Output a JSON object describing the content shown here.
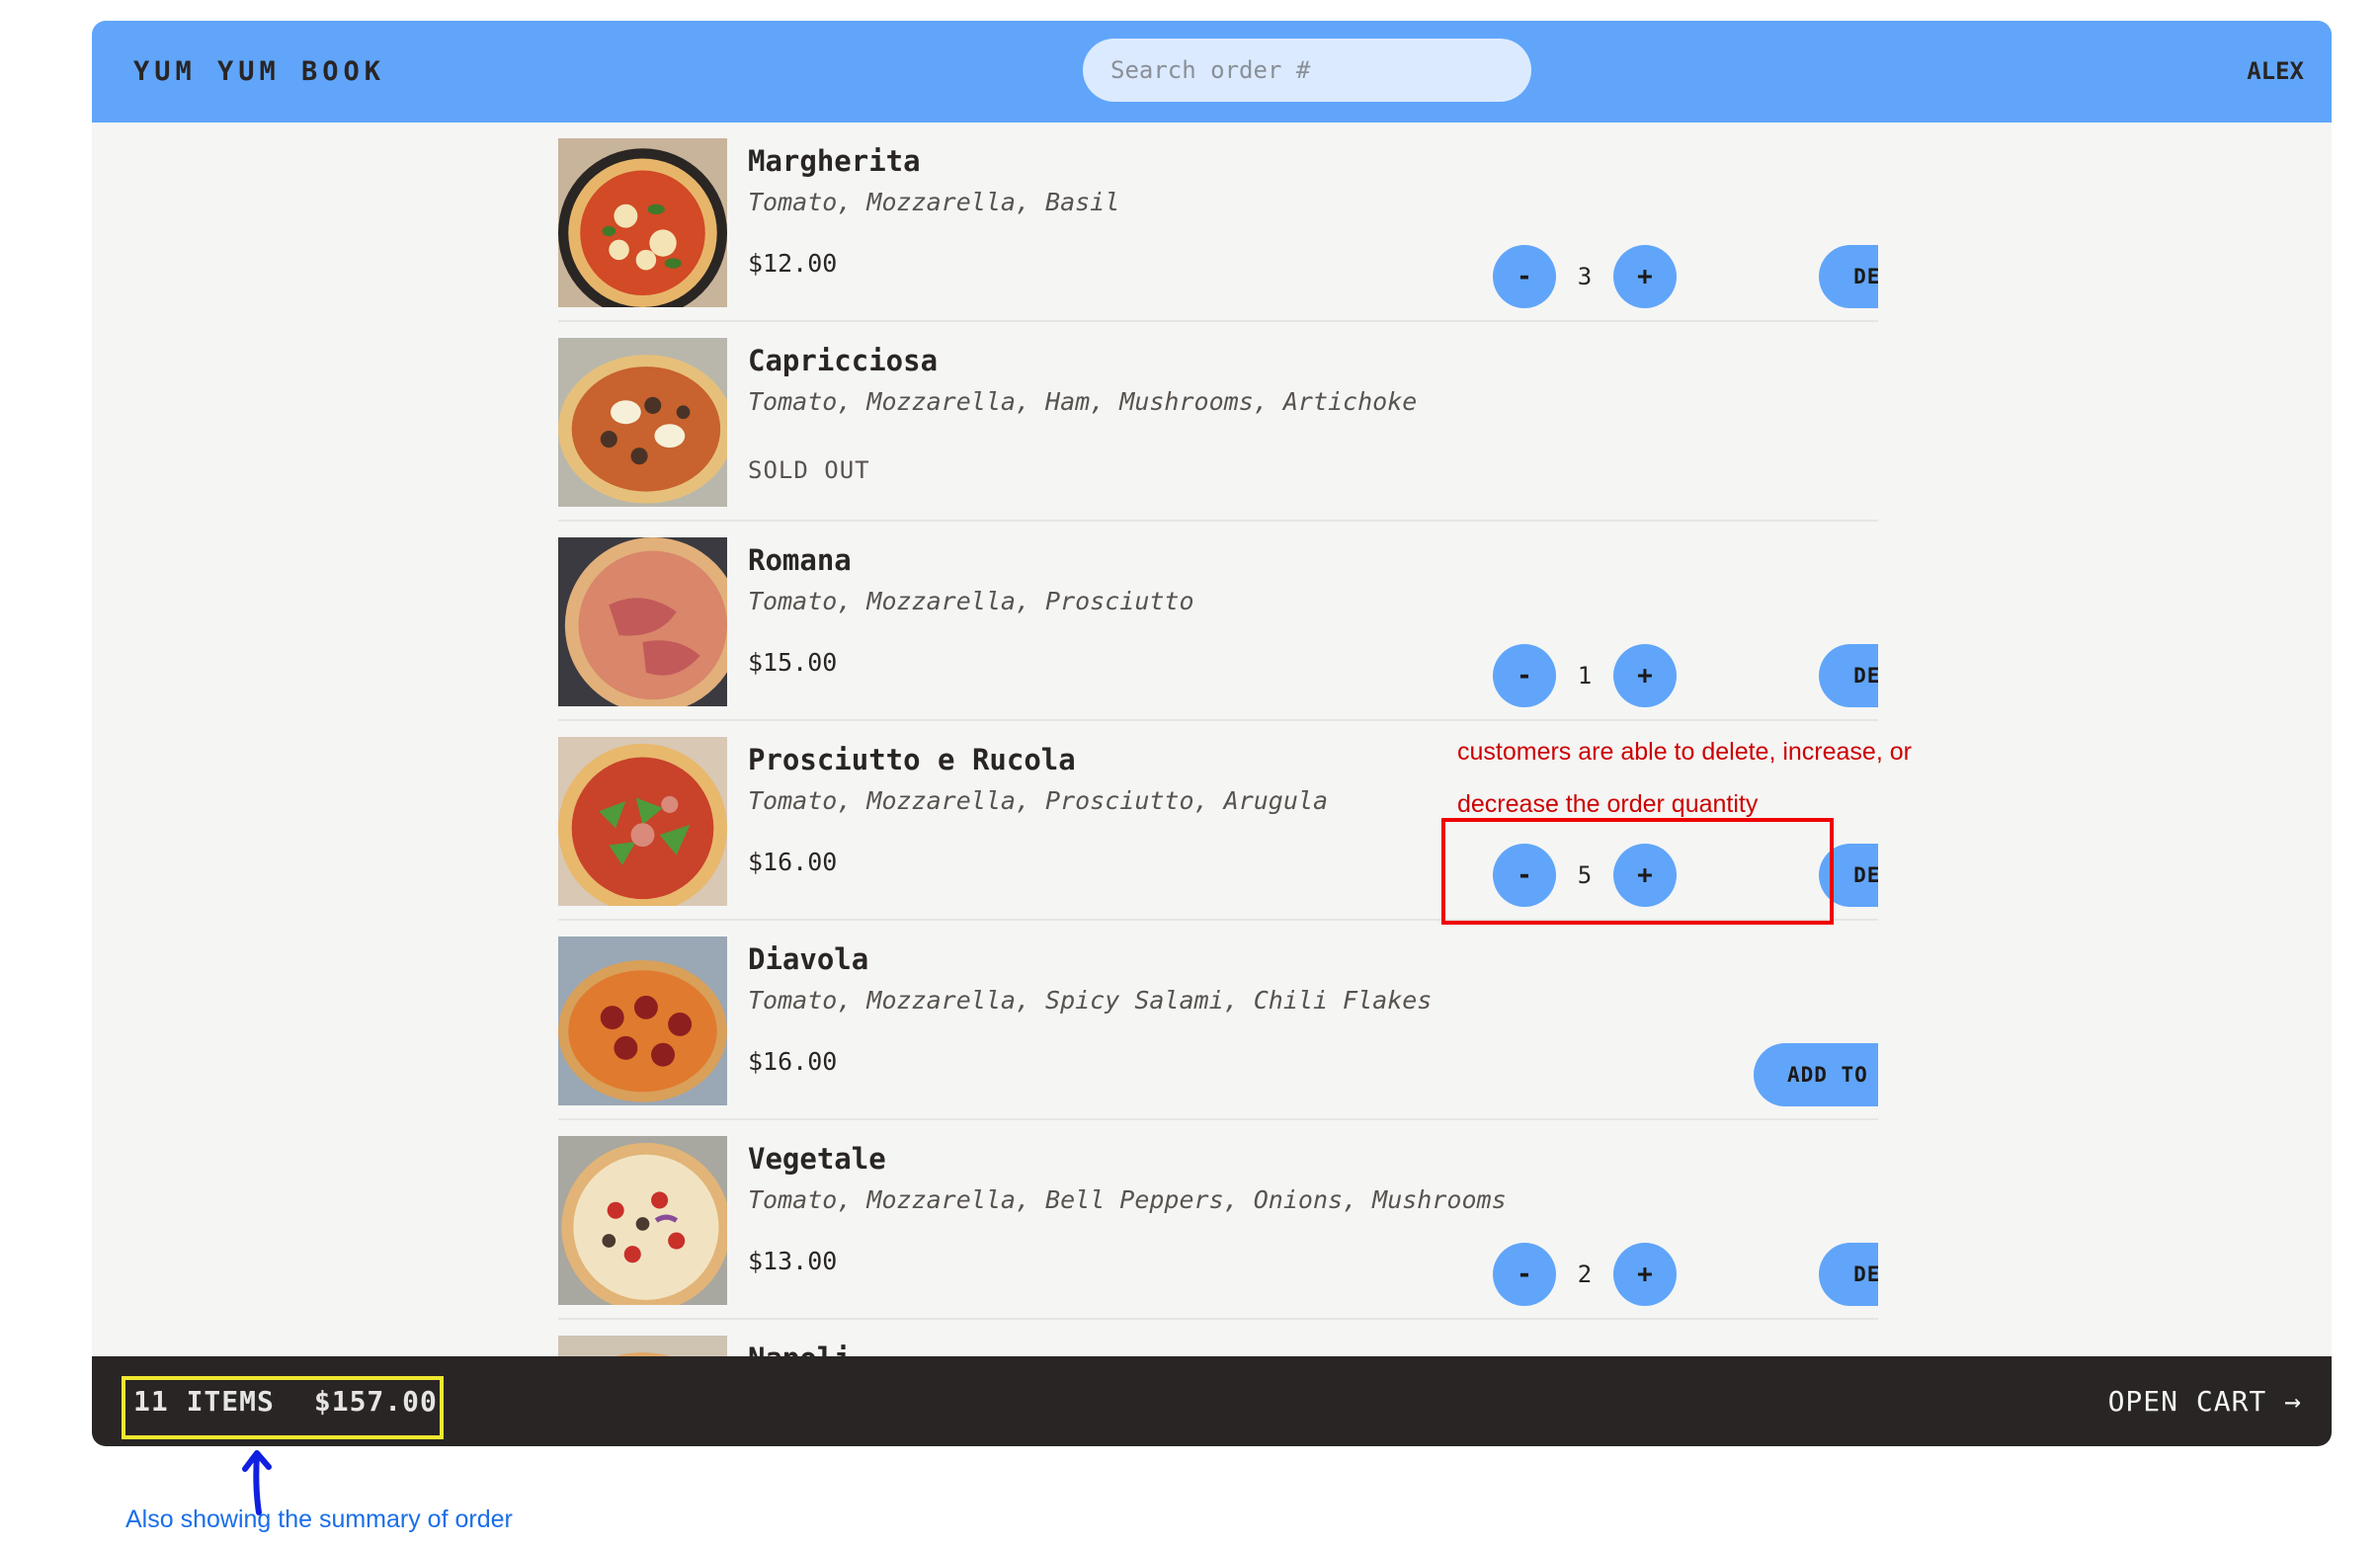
{
  "header": {
    "logo": "YUM YUM BOOK",
    "search_placeholder": "Search order #",
    "user": "ALEX"
  },
  "menu_items": [
    {
      "name": "Margherita",
      "ingredients": "Tomato, Mozzarella, Basil",
      "price": "$12.00",
      "quantity": "3",
      "state": "in_cart"
    },
    {
      "name": "Capricciosa",
      "ingredients": "Tomato, Mozzarella, Ham, Mushrooms, Artichoke",
      "status": "SOLD OUT",
      "state": "sold_out"
    },
    {
      "name": "Romana",
      "ingredients": "Tomato, Mozzarella, Prosciutto",
      "price": "$15.00",
      "quantity": "1",
      "state": "in_cart"
    },
    {
      "name": "Prosciutto e Rucola",
      "ingredients": "Tomato, Mozzarella, Prosciutto, Arugula",
      "price": "$16.00",
      "quantity": "5",
      "state": "in_cart"
    },
    {
      "name": "Diavola",
      "ingredients": "Tomato, Mozzarella, Spicy Salami, Chili Flakes",
      "price": "$16.00",
      "state": "available"
    },
    {
      "name": "Vegetale",
      "ingredients": "Tomato, Mozzarella, Bell Peppers, Onions, Mushrooms",
      "price": "$13.00",
      "quantity": "2",
      "state": "in_cart"
    },
    {
      "name": "Napoli",
      "state": "partial"
    }
  ],
  "buttons": {
    "decrease": "-",
    "increase": "+",
    "delete": "DELETE",
    "add_to_cart": "ADD TO CART"
  },
  "footer": {
    "items_count": "11 ITEMS",
    "total": "$157.00",
    "open_cart": "OPEN CART →"
  },
  "annotations": {
    "red_note": "customers are able to delete, increase, or decrease the order quantity",
    "blue_note": "Also showing the summary of order"
  },
  "colors": {
    "accent": "#60a5fa",
    "header_bg": "#60a5fa",
    "footer_bg": "#292524",
    "annotation_red": "#cc0000",
    "annotation_yellow": "#f0e830",
    "annotation_blue": "#1a6ee8"
  }
}
